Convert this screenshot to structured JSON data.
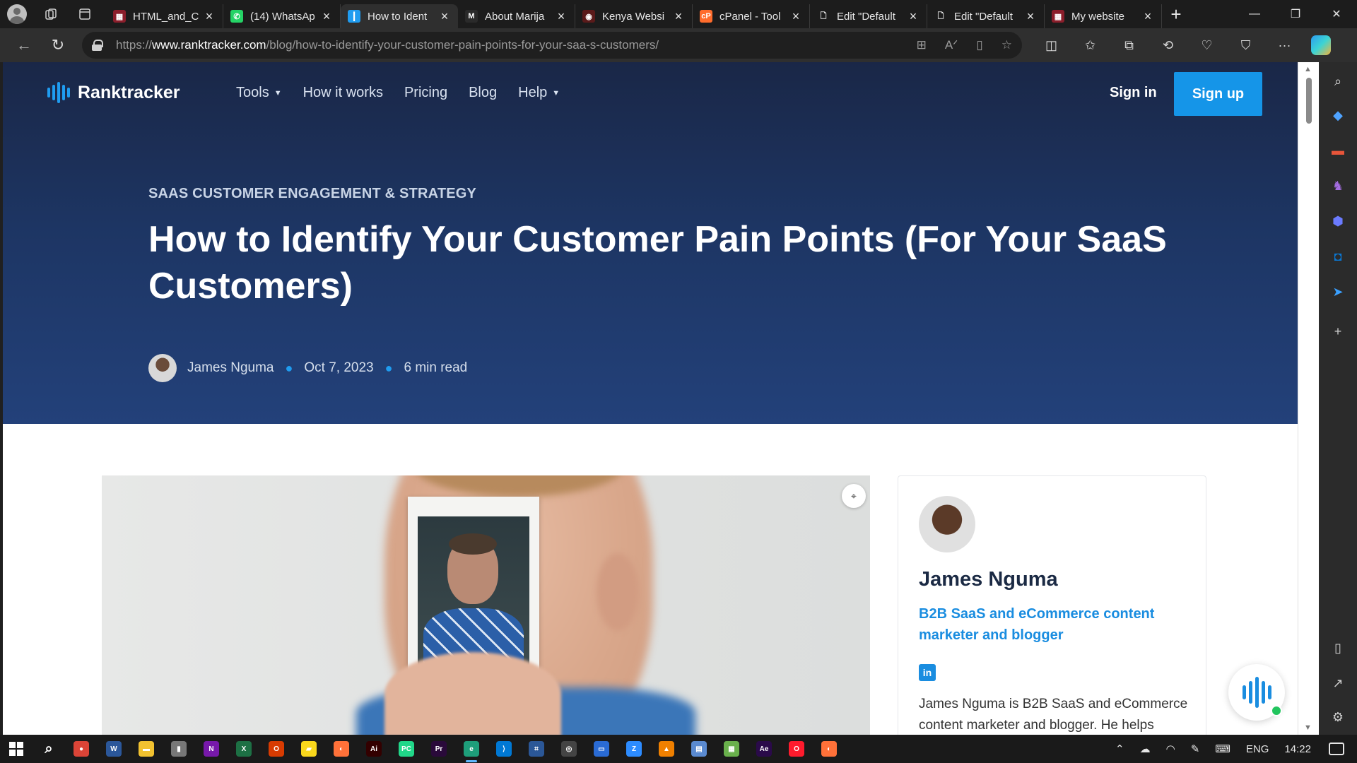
{
  "browser": {
    "tabs": [
      {
        "title": "HTML_and_C",
        "fav_color": "#8b1e2b",
        "fav_glyph": "▦"
      },
      {
        "title": "(14) WhatsAp",
        "fav_color": "#25d366",
        "fav_glyph": "✆"
      },
      {
        "title": "How to Ident",
        "fav_color": "#1f9cf0",
        "fav_glyph": "┃",
        "active": true
      },
      {
        "title": "About Marija",
        "fav_color": "#2a2a2a",
        "fav_glyph": "M"
      },
      {
        "title": "Kenya Websi",
        "fav_color": "#5a1a1a",
        "fav_glyph": "◉"
      },
      {
        "title": "cPanel - Tool",
        "fav_color": "#ff6c2c",
        "fav_glyph": "cP"
      },
      {
        "title": "Edit \"Default",
        "fav_color": "transparent",
        "fav_glyph": "🗋"
      },
      {
        "title": "Edit \"Default",
        "fav_color": "transparent",
        "fav_glyph": "🗋"
      },
      {
        "title": "My website",
        "fav_color": "#8b1e2b",
        "fav_glyph": "▦"
      }
    ],
    "url": {
      "scheme": "https://",
      "domain": "www.ranktracker.com",
      "path": "/blog/how-to-identify-your-customer-pain-points-for-your-saa-s-customers/"
    }
  },
  "site": {
    "logo_text": "Ranktracker",
    "nav": [
      {
        "label": "Tools",
        "dropdown": true
      },
      {
        "label": "How it works",
        "dropdown": false
      },
      {
        "label": "Pricing",
        "dropdown": false
      },
      {
        "label": "Blog",
        "dropdown": false
      },
      {
        "label": "Help",
        "dropdown": true
      }
    ],
    "signin_label": "Sign in",
    "signup_label": "Sign up",
    "accent_color": "#1595e8"
  },
  "article": {
    "category": "SAAS CUSTOMER ENGAGEMENT & STRATEGY",
    "title": "How to Identify Your Customer Pain Points (For Your SaaS Customers)",
    "author": "James Nguma",
    "date": "Oct 7, 2023",
    "read_time": "6 min read"
  },
  "author_card": {
    "name": "James Nguma",
    "role": "B2B SaaS and eCommerce content marketer and blogger",
    "linkedin_label": "in",
    "bio": "James Nguma is B2B SaaS and eCommerce content marketer and blogger. He helps"
  },
  "taskbar": {
    "apps": [
      {
        "name": "search",
        "color": "transparent",
        "glyph": "⌕"
      },
      {
        "name": "chrome",
        "color": "#db4437",
        "glyph": "●"
      },
      {
        "name": "word",
        "color": "#2b579a",
        "glyph": "W"
      },
      {
        "name": "file-explorer",
        "color": "#f2c230",
        "glyph": "▬"
      },
      {
        "name": "usb",
        "color": "#777777",
        "glyph": "▮"
      },
      {
        "name": "onenote",
        "color": "#7719aa",
        "glyph": "N"
      },
      {
        "name": "excel",
        "color": "#1d7044",
        "glyph": "X"
      },
      {
        "name": "office",
        "color": "#d83b01",
        "glyph": "O"
      },
      {
        "name": "sticky-notes",
        "color": "#f9d71c",
        "glyph": "▰"
      },
      {
        "name": "firefox",
        "color": "#ff7139",
        "glyph": "◐"
      },
      {
        "name": "illustrator",
        "color": "#330000",
        "glyph": "Ai"
      },
      {
        "name": "pycharm",
        "color": "#21d789",
        "glyph": "PC"
      },
      {
        "name": "premiere",
        "color": "#2a0a3a",
        "glyph": "Pr"
      },
      {
        "name": "edge",
        "color": "#1e9e7a",
        "glyph": "e",
        "active": true
      },
      {
        "name": "vscode",
        "color": "#0078d4",
        "glyph": "⟩"
      },
      {
        "name": "network",
        "color": "#2b5797",
        "glyph": "⌗"
      },
      {
        "name": "obs",
        "color": "#444444",
        "glyph": "◎"
      },
      {
        "name": "window-app",
        "color": "#2a6bd4",
        "glyph": "▭"
      },
      {
        "name": "zoom",
        "color": "#2d8cff",
        "glyph": "Z"
      },
      {
        "name": "vlc",
        "color": "#f08000",
        "glyph": "▲"
      },
      {
        "name": "remote",
        "color": "#5a8ad0",
        "glyph": "▤"
      },
      {
        "name": "windows-app",
        "color": "#6ab04c",
        "glyph": "▦"
      },
      {
        "name": "after-effects",
        "color": "#2a0a4a",
        "glyph": "Ae"
      },
      {
        "name": "opera",
        "color": "#ff1b2d",
        "glyph": "O"
      },
      {
        "name": "firefox-2",
        "color": "#ff7139",
        "glyph": "◐"
      }
    ],
    "language": "ENG",
    "time": "14:22"
  }
}
